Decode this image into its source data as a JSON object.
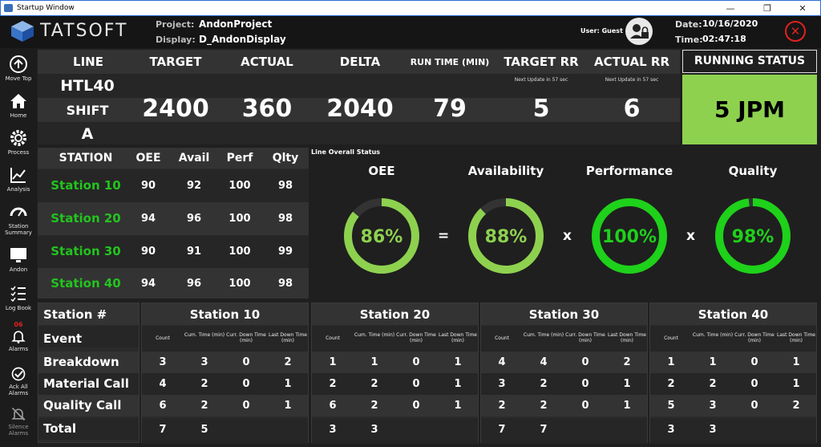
{
  "window": {
    "title": "Startup Window",
    "buttons": [
      "—",
      "❐",
      "✕"
    ]
  },
  "header": {
    "logo": "TATSOFT",
    "project_label": "Project:",
    "project_value": "AndonProject",
    "display_label": "Display:",
    "display_value": "D_AndonDisplay",
    "user_label": "User: Guest",
    "date_label": "Date:",
    "date_value": "10/16/2020",
    "time_label": "Time:",
    "time_value": "02:47:18"
  },
  "sidebar": [
    {
      "label": "Move Top",
      "icon": "arrow-up-icon"
    },
    {
      "label": "Home",
      "icon": "home-icon"
    },
    {
      "label": "Process",
      "icon": "gear-icon"
    },
    {
      "label": "Analysis",
      "icon": "chart-icon"
    },
    {
      "label": "Station Summary",
      "icon": "gauge-icon"
    },
    {
      "label": "Andon",
      "icon": "monitor-icon"
    },
    {
      "label": "Log Book",
      "icon": "checklist-icon"
    },
    {
      "label": "Alarms",
      "icon": "bell-icon",
      "badge": "06"
    },
    {
      "label": "Ack All Alarms",
      "icon": "check-circle-icon"
    },
    {
      "label": "Silence Alarms",
      "icon": "bell-off-icon"
    }
  ],
  "kpi": {
    "headers": [
      "LINE",
      "TARGET",
      "ACTUAL",
      "DELTA",
      "RUN TIME (MIN)",
      "TARGET RR",
      "ACTUAL RR"
    ],
    "line_lines": [
      "HTL40",
      "SHIFT",
      "A"
    ],
    "values": [
      "2400",
      "360",
      "2040",
      "79",
      "5",
      "6"
    ],
    "target_rr_note": "Next Update in 57 sec",
    "actual_rr_note": "Next Update in 57 sec"
  },
  "running_status": {
    "title": "RUNNING STATUS",
    "value": "5 JPM",
    "color": "#8ed14f"
  },
  "stations_table": {
    "headers": [
      "STATION",
      "OEE",
      "Avail",
      "Perf",
      "Qlty"
    ],
    "rows": [
      {
        "name": "Station 10",
        "values": [
          "90",
          "92",
          "100",
          "98"
        ]
      },
      {
        "name": "Station 20",
        "values": [
          "94",
          "96",
          "100",
          "98"
        ]
      },
      {
        "name": "Station 30",
        "values": [
          "90",
          "91",
          "100",
          "99"
        ]
      },
      {
        "name": "Station 40",
        "values": [
          "94",
          "96",
          "100",
          "98"
        ]
      }
    ]
  },
  "line_status": {
    "title": "Line Overall Status",
    "gauges": [
      {
        "label": "OEE",
        "value": 86,
        "text": "86%",
        "color": "#8ed14f"
      },
      {
        "label": "Availability",
        "value": 88,
        "text": "88%",
        "color": "#8ed14f"
      },
      {
        "label": "Performance",
        "value": 100,
        "text": "100%",
        "color": "#1ed11a"
      },
      {
        "label": "Quality",
        "value": 98,
        "text": "98%",
        "color": "#1ed11a"
      }
    ],
    "operators": [
      "=",
      "x",
      "x"
    ]
  },
  "bottom": {
    "row_labels": [
      "Station #",
      "Event",
      "Breakdown",
      "Material Call",
      "Quality Call",
      "Total"
    ],
    "col_headers": [
      "Count",
      "Cum. Time (min)",
      "Curr. Down Time (min)",
      "Last Down Time (min)"
    ],
    "stations": [
      {
        "name": "Station 10",
        "rows": [
          [
            "3",
            "3",
            "0",
            "2"
          ],
          [
            "4",
            "2",
            "0",
            "1"
          ],
          [
            "6",
            "2",
            "0",
            "1"
          ]
        ],
        "total": [
          "7",
          "5"
        ]
      },
      {
        "name": "Station 20",
        "rows": [
          [
            "1",
            "1",
            "0",
            "1"
          ],
          [
            "2",
            "2",
            "0",
            "1"
          ],
          [
            "6",
            "2",
            "0",
            "1"
          ]
        ],
        "total": [
          "3",
          "3"
        ]
      },
      {
        "name": "Station 30",
        "rows": [
          [
            "4",
            "4",
            "0",
            "2"
          ],
          [
            "3",
            "2",
            "0",
            "1"
          ],
          [
            "2",
            "2",
            "0",
            "1"
          ]
        ],
        "total": [
          "7",
          "7"
        ]
      },
      {
        "name": "Station 40",
        "rows": [
          [
            "1",
            "1",
            "0",
            "1"
          ],
          [
            "2",
            "2",
            "0",
            "1"
          ],
          [
            "5",
            "3",
            "0",
            "2"
          ]
        ],
        "total": [
          "3",
          "3"
        ]
      }
    ]
  }
}
